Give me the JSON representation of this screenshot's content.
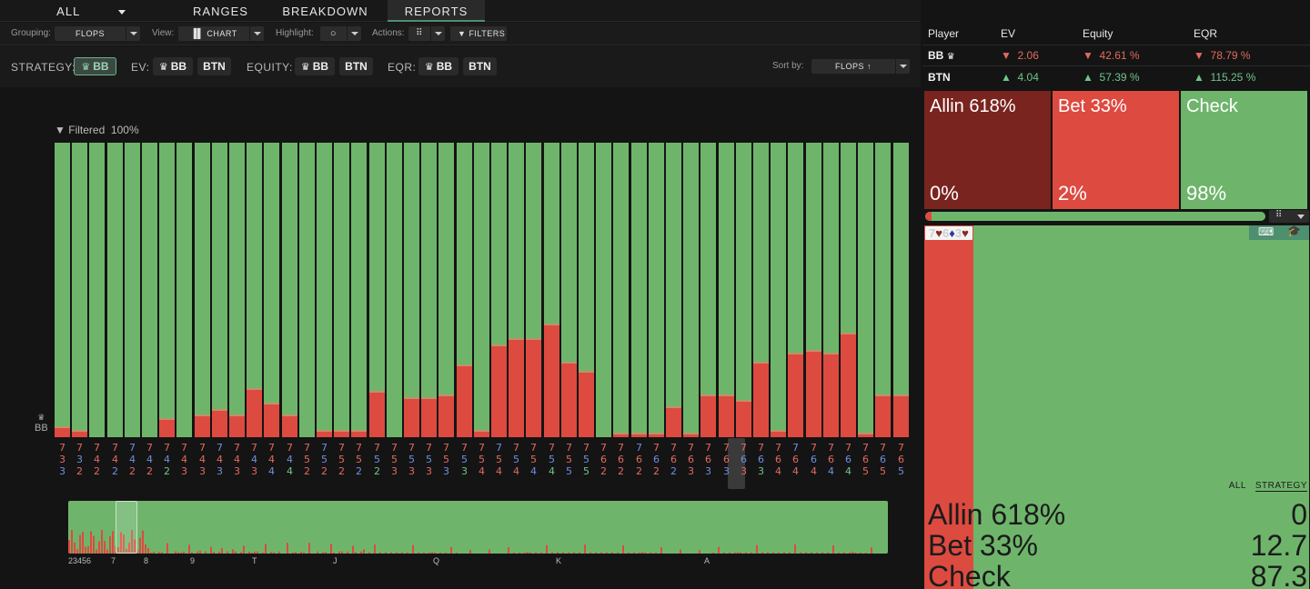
{
  "tabs": {
    "all": "ALL",
    "ranges": "RANGES",
    "breakdown": "BREAKDOWN",
    "reports": "REPORTS"
  },
  "toolbar": {
    "grouping_label": "Grouping:",
    "grouping_value": "FLOPS",
    "view_label": "View:",
    "view_value": "CHART",
    "highlight_label": "Highlight:",
    "actions_label": "Actions:",
    "filters_label": "FILTERS"
  },
  "strategy": {
    "strategy_label": "STRATEGY:",
    "ev_label": "EV:",
    "equity_label": "EQUITY:",
    "eqr_label": "EQR:",
    "bb": "BB",
    "btn": "BTN",
    "sort_label": "Sort by:",
    "sort_value": "FLOPS"
  },
  "chart": {
    "filtered_label": "Filtered",
    "filtered_value": "100%",
    "player_label": "BB",
    "overview_ticks": [
      "23456",
      "7",
      "8",
      "9",
      "T",
      "J",
      "Q",
      "K",
      "A"
    ]
  },
  "chart_data": {
    "type": "bar",
    "stacked": true,
    "series": [
      {
        "name": "Check"
      },
      {
        "name": "Bet 33%"
      },
      {
        "name": "Allin 618%"
      }
    ],
    "flops": [
      {
        "c": [
          "7",
          "3",
          "3"
        ],
        "s": [
          "r",
          "r",
          "b"
        ],
        "bet": 3
      },
      {
        "c": [
          "7",
          "3",
          "2"
        ],
        "s": [
          "r",
          "b",
          "r"
        ],
        "bet": 2
      },
      {
        "c": [
          "7",
          "4",
          "2"
        ],
        "s": [
          "r",
          "r",
          "r"
        ],
        "bet": 0
      },
      {
        "c": [
          "7",
          "4",
          "2"
        ],
        "s": [
          "r",
          "r",
          "b"
        ],
        "bet": 0
      },
      {
        "c": [
          "7",
          "4",
          "2"
        ],
        "s": [
          "b",
          "b",
          "r"
        ],
        "bet": 0
      },
      {
        "c": [
          "7",
          "4",
          "2"
        ],
        "s": [
          "r",
          "b",
          "r"
        ],
        "bet": 0
      },
      {
        "c": [
          "7",
          "4",
          "2"
        ],
        "s": [
          "r",
          "b",
          "g"
        ],
        "bet": 6
      },
      {
        "c": [
          "7",
          "4",
          "3"
        ],
        "s": [
          "r",
          "r",
          "r"
        ],
        "bet": 0
      },
      {
        "c": [
          "7",
          "4",
          "3"
        ],
        "s": [
          "r",
          "r",
          "r"
        ],
        "bet": 7
      },
      {
        "c": [
          "7",
          "4",
          "3"
        ],
        "s": [
          "b",
          "r",
          "b"
        ],
        "bet": 9
      },
      {
        "c": [
          "7",
          "4",
          "3"
        ],
        "s": [
          "r",
          "r",
          "r"
        ],
        "bet": 7
      },
      {
        "c": [
          "7",
          "4",
          "3"
        ],
        "s": [
          "r",
          "b",
          "r"
        ],
        "bet": 16
      },
      {
        "c": [
          "7",
          "4",
          "4"
        ],
        "s": [
          "r",
          "r",
          "b"
        ],
        "bet": 11
      },
      {
        "c": [
          "7",
          "4",
          "4"
        ],
        "s": [
          "r",
          "b",
          "g"
        ],
        "bet": 7
      },
      {
        "c": [
          "7",
          "5",
          "2"
        ],
        "s": [
          "r",
          "r",
          "r"
        ],
        "bet": 0
      },
      {
        "c": [
          "7",
          "5",
          "2"
        ],
        "s": [
          "b",
          "b",
          "r"
        ],
        "bet": 2
      },
      {
        "c": [
          "7",
          "5",
          "2"
        ],
        "s": [
          "r",
          "r",
          "r"
        ],
        "bet": 2
      },
      {
        "c": [
          "7",
          "5",
          "2"
        ],
        "s": [
          "r",
          "r",
          "b"
        ],
        "bet": 2
      },
      {
        "c": [
          "7",
          "5",
          "2"
        ],
        "s": [
          "r",
          "b",
          "g"
        ],
        "bet": 15
      },
      {
        "c": [
          "7",
          "5",
          "3"
        ],
        "s": [
          "r",
          "r",
          "r"
        ],
        "bet": 0
      },
      {
        "c": [
          "7",
          "5",
          "3"
        ],
        "s": [
          "r",
          "b",
          "r"
        ],
        "bet": 13
      },
      {
        "c": [
          "7",
          "5",
          "3"
        ],
        "s": [
          "r",
          "b",
          "r"
        ],
        "bet": 13
      },
      {
        "c": [
          "7",
          "5",
          "3"
        ],
        "s": [
          "r",
          "r",
          "b"
        ],
        "bet": 14
      },
      {
        "c": [
          "7",
          "5",
          "3"
        ],
        "s": [
          "r",
          "b",
          "g"
        ],
        "bet": 24
      },
      {
        "c": [
          "7",
          "5",
          "4"
        ],
        "s": [
          "r",
          "r",
          "r"
        ],
        "bet": 2
      },
      {
        "c": [
          "7",
          "5",
          "4"
        ],
        "s": [
          "b",
          "r",
          "r"
        ],
        "bet": 31
      },
      {
        "c": [
          "7",
          "5",
          "4"
        ],
        "s": [
          "r",
          "b",
          "r"
        ],
        "bet": 33
      },
      {
        "c": [
          "7",
          "5",
          "4"
        ],
        "s": [
          "r",
          "r",
          "b"
        ],
        "bet": 33
      },
      {
        "c": [
          "7",
          "5",
          "4"
        ],
        "s": [
          "r",
          "b",
          "g"
        ],
        "bet": 38
      },
      {
        "c": [
          "7",
          "5",
          "5"
        ],
        "s": [
          "r",
          "r",
          "b"
        ],
        "bet": 25
      },
      {
        "c": [
          "7",
          "5",
          "5"
        ],
        "s": [
          "r",
          "b",
          "g"
        ],
        "bet": 22
      },
      {
        "c": [
          "7",
          "6",
          "2"
        ],
        "s": [
          "r",
          "r",
          "r"
        ],
        "bet": 0
      },
      {
        "c": [
          "7",
          "6",
          "2"
        ],
        "s": [
          "r",
          "r",
          "r"
        ],
        "bet": 1
      },
      {
        "c": [
          "7",
          "6",
          "2"
        ],
        "s": [
          "b",
          "r",
          "r"
        ],
        "bet": 1
      },
      {
        "c": [
          "7",
          "6",
          "2"
        ],
        "s": [
          "r",
          "b",
          "r"
        ],
        "bet": 1
      },
      {
        "c": [
          "7",
          "6",
          "2"
        ],
        "s": [
          "r",
          "r",
          "b"
        ],
        "bet": 10
      },
      {
        "c": [
          "7",
          "6",
          "3"
        ],
        "s": [
          "r",
          "r",
          "r"
        ],
        "bet": 1
      },
      {
        "c": [
          "7",
          "6",
          "3"
        ],
        "s": [
          "r",
          "r",
          "b"
        ],
        "bet": 14
      },
      {
        "c": [
          "7",
          "6",
          "3"
        ],
        "s": [
          "r",
          "r",
          "b"
        ],
        "bet": 14
      },
      {
        "c": [
          "7",
          "6",
          "3"
        ],
        "s": [
          "r",
          "b",
          "r"
        ],
        "bet": 12
      },
      {
        "c": [
          "7",
          "6",
          "3"
        ],
        "s": [
          "r",
          "b",
          "g"
        ],
        "bet": 25
      },
      {
        "c": [
          "7",
          "6",
          "4"
        ],
        "s": [
          "r",
          "r",
          "r"
        ],
        "bet": 2
      },
      {
        "c": [
          "7",
          "6",
          "4"
        ],
        "s": [
          "b",
          "r",
          "r"
        ],
        "bet": 28
      },
      {
        "c": [
          "7",
          "6",
          "4"
        ],
        "s": [
          "r",
          "b",
          "r"
        ],
        "bet": 29
      },
      {
        "c": [
          "7",
          "6",
          "4"
        ],
        "s": [
          "r",
          "r",
          "b"
        ],
        "bet": 28
      },
      {
        "c": [
          "7",
          "6",
          "4"
        ],
        "s": [
          "r",
          "b",
          "g"
        ],
        "bet": 35
      },
      {
        "c": [
          "7",
          "6",
          "5"
        ],
        "s": [
          "r",
          "r",
          "r"
        ],
        "bet": 1
      },
      {
        "c": [
          "7",
          "6",
          "5"
        ],
        "s": [
          "r",
          "b",
          "r"
        ],
        "bet": 14
      },
      {
        "c": [
          "7",
          "6",
          "5"
        ],
        "s": [
          "r",
          "r",
          "b"
        ],
        "bet": 14
      }
    ],
    "selected_index": 39
  },
  "players": {
    "headers": {
      "player": "Player",
      "ev": "EV",
      "equity": "Equity",
      "eqr": "EQR"
    },
    "rows": [
      {
        "name": "BB",
        "ev": "2.06",
        "equity": "42.61 %",
        "eqr": "78.79 %",
        "dir": "down"
      },
      {
        "name": "BTN",
        "ev": "4.04",
        "equity": "57.39 %",
        "eqr": "115.25 %",
        "dir": "up"
      }
    ]
  },
  "actions": [
    {
      "name": "Allin 618%",
      "pct": "0%",
      "color": "#7a2420"
    },
    {
      "name": "Bet 33%",
      "pct": "2%",
      "color": "#dd4a40"
    },
    {
      "name": "Check",
      "pct": "98%",
      "color": "#6eb56b"
    }
  ],
  "colors": {
    "check": "#6eb56b",
    "bet": "#dd4a40",
    "allin": "#7a2420",
    "accent": "#4d8f6e"
  },
  "selected_board": {
    "c1": "7",
    "c2": "6",
    "c3": "3"
  },
  "hand_view": {
    "bet_share": 0.127,
    "all_label": "ALL",
    "strategy_label": "STRATEGY",
    "rows": [
      {
        "name": "Allin 618%",
        "value": "0"
      },
      {
        "name": "Bet 33%",
        "value": "12.7"
      },
      {
        "name": "Check",
        "value": "87.3"
      }
    ]
  }
}
